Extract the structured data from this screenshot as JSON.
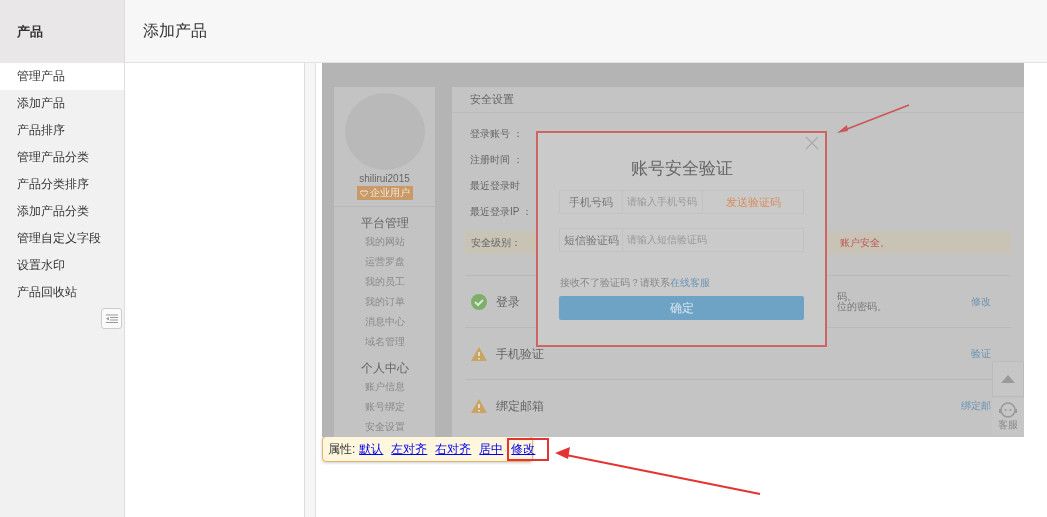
{
  "sidebar": {
    "title": "产品",
    "items": [
      {
        "label": "管理产品",
        "selected": true
      },
      {
        "label": "添加产品",
        "selected": false
      },
      {
        "label": "产品排序",
        "selected": false
      },
      {
        "label": "管理产品分类",
        "selected": false
      },
      {
        "label": "产品分类排序",
        "selected": false
      },
      {
        "label": "添加产品分类",
        "selected": false
      },
      {
        "label": "管理自定义字段",
        "selected": false
      },
      {
        "label": "设置水印",
        "selected": false
      },
      {
        "label": "产品回收站",
        "selected": false
      }
    ]
  },
  "header": {
    "title": "添加产品"
  },
  "embedded_screenshot": {
    "profile": {
      "username": "shilirui2015",
      "badge": "企业用户",
      "sections": [
        {
          "title": "平台管理",
          "items": [
            "我的网站",
            "运营罗盘",
            "我的员工",
            "我的订单",
            "消息中心",
            "域名管理"
          ]
        },
        {
          "title": "个人中心",
          "items": [
            "账户信息",
            "账号绑定",
            "安全设置"
          ]
        }
      ]
    },
    "security": {
      "title": "安全设置",
      "fields": [
        "登录账号 ：",
        "注册时间 ：",
        "最近登录时",
        "最近登录IP ："
      ],
      "level": {
        "label": "安全级别：",
        "note": "账户安全。"
      },
      "items": [
        {
          "kind": "ok",
          "title": "登录",
          "desc": [
            "码。",
            "位的密码。"
          ],
          "action": "修改"
        },
        {
          "kind": "warn",
          "title": "手机验证",
          "action": "验证"
        },
        {
          "kind": "warn",
          "title": "绑定邮箱",
          "action": "绑定邮"
        }
      ]
    },
    "side_widget": {
      "service_label": "客服"
    },
    "dialog": {
      "title": "账号安全验证",
      "phone": {
        "label": "手机号码",
        "placeholder": "请输入手机号码",
        "button": "发送验证码"
      },
      "code": {
        "label": "短信验证码",
        "placeholder": "请输入短信验证码"
      },
      "help": {
        "text": "接收不了验证码？请联系",
        "link": "在线客服"
      },
      "confirm": "确定"
    }
  },
  "image_toolbar": {
    "label": "属性:",
    "links": [
      {
        "label": "默认",
        "highlighted": false
      },
      {
        "label": "左对齐",
        "highlighted": false
      },
      {
        "label": "右对齐",
        "highlighted": false
      },
      {
        "label": "居中",
        "highlighted": false
      },
      {
        "label": "修改",
        "highlighted": true
      }
    ]
  }
}
